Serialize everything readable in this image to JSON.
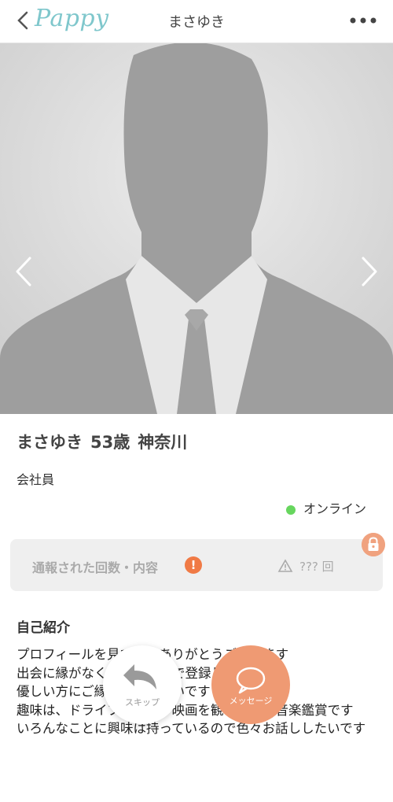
{
  "header": {
    "logo": "Pappy",
    "title": "まさゆき",
    "back_icon": "chevron-left-icon",
    "menu_icon": "more-dots-icon"
  },
  "photo": {
    "prev_icon": "chevron-left-icon",
    "next_icon": "chevron-right-icon"
  },
  "profile": {
    "name": "まさゆき",
    "age": "53歳",
    "location": "神奈川",
    "occupation": "会社員",
    "status": "オンライン",
    "status_color": "#67d65e"
  },
  "report": {
    "label": "通報された回数・内容",
    "alert": "!",
    "count": "??? 回"
  },
  "intro": {
    "heading": "自己紹介",
    "text": "プロフィールを見て頂きありがとうございます\n出会に縁がなく知人の紹介で登録してみました\n優しい方にご縁あれば嬉しいです\n趣味は、ドライブ、旅行、映画を観ることと音楽鑑賞です\nいろんなことに興味は持っているので色々お話ししたいです"
  },
  "actions": {
    "skip_label": "スキップ",
    "message_label": "メッセージ",
    "message_color": "#ef9a73"
  }
}
